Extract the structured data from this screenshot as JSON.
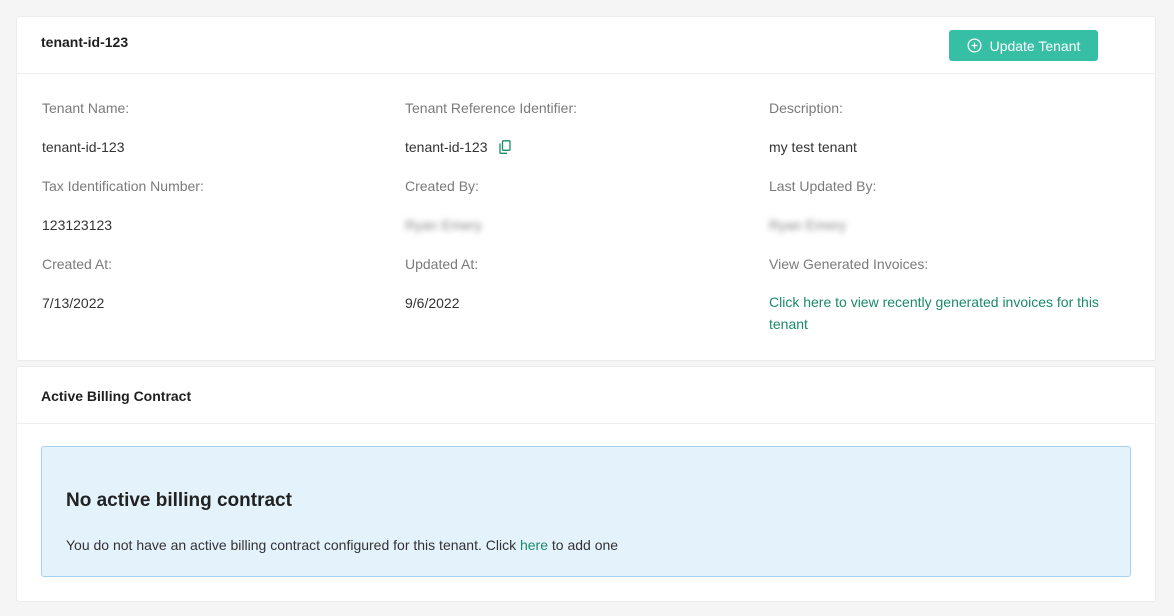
{
  "tenant_card": {
    "title": "tenant-id-123",
    "update_button_label": "Update Tenant",
    "fields": {
      "tenant_name_label": "Tenant Name:",
      "tenant_name_value": "tenant-id-123",
      "reference_label": "Tenant Reference Identifier:",
      "reference_value": "tenant-id-123",
      "description_label": "Description:",
      "description_value": "my test tenant",
      "tax_label": "Tax Identification Number:",
      "tax_value": "123123123",
      "created_by_label": "Created By:",
      "created_by_value": "Ryan Emery",
      "last_updated_by_label": "Last Updated By:",
      "last_updated_by_value": "Ryan Emery",
      "created_at_label": "Created At:",
      "created_at_value": "7/13/2022",
      "updated_at_label": "Updated At:",
      "updated_at_value": "9/6/2022",
      "invoices_label": "View Generated Invoices:",
      "invoices_link": "Click here to view recently generated invoices for this tenant"
    }
  },
  "billing_card": {
    "title": "Active Billing Contract",
    "alert": {
      "title": "No active billing contract",
      "text_before": "You do not have an active billing contract configured for this tenant. Click ",
      "link": "here",
      "text_after": " to add one"
    }
  },
  "colors": {
    "accent": "#36bfa4",
    "link": "#1a8a6a",
    "alert_bg": "#e4f2fc",
    "alert_border": "#a6d2f0"
  },
  "icons": {
    "update_button": "plus-circle-icon",
    "copy": "copy-icon"
  }
}
